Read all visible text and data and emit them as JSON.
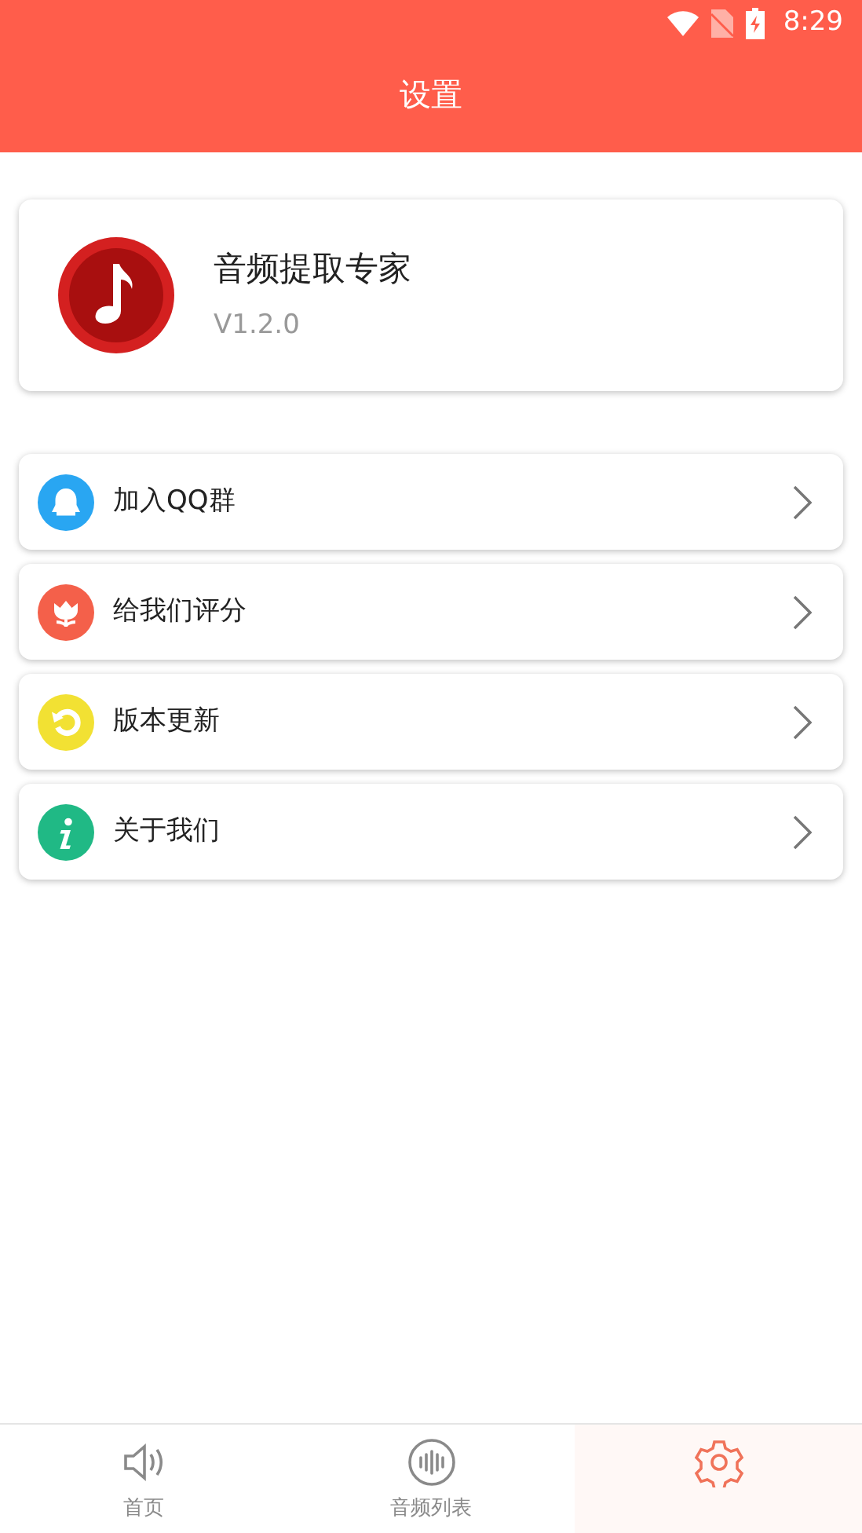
{
  "status_bar": {
    "time": "8:29"
  },
  "header": {
    "title": "设置"
  },
  "app_card": {
    "name": "音频提取专家",
    "version": "V1.2.0"
  },
  "menu": [
    {
      "kind": "qq",
      "label": "加入QQ群",
      "color": "#29a6f2"
    },
    {
      "kind": "rate",
      "label": "给我们评分",
      "color": "#f4604a"
    },
    {
      "kind": "update",
      "label": "版本更新",
      "color": "#f2e133"
    },
    {
      "kind": "about",
      "label": "关于我们",
      "color": "#20b985"
    }
  ],
  "tabs": [
    {
      "kind": "home",
      "label": "首页",
      "selected": false
    },
    {
      "kind": "list",
      "label": "音频列表",
      "selected": false
    },
    {
      "kind": "settings",
      "selected": true
    }
  ]
}
